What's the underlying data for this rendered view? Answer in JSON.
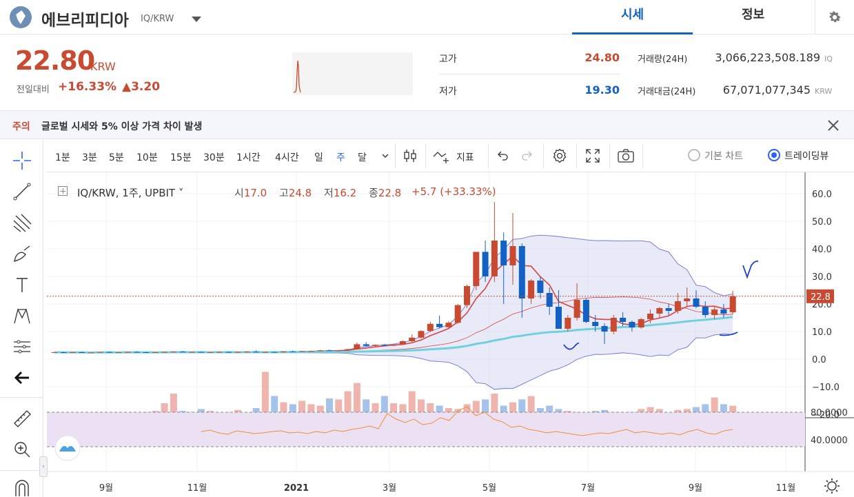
{
  "header": {
    "coin_name": "에브리피디아",
    "pair": "IQ/KRW",
    "tabs": [
      "시세",
      "정보"
    ],
    "active_tab": "시세"
  },
  "summary": {
    "price": "22.80",
    "unit": "KRW",
    "change_label": "전일대비",
    "change_rate": "+16.33%",
    "change_amount": "▲3.20",
    "high_label": "고가",
    "high_value": "24.80",
    "low_label": "저가",
    "low_value": "19.30",
    "volume_label": "거래량(24H)",
    "volume_value": "3,066,223,508.189",
    "volume_unit": "IQ",
    "amount_label": "거래대금(24H)",
    "amount_value": "67,071,077,345",
    "amount_unit": "KRW"
  },
  "notice": {
    "tag": "주의",
    "text": "글로벌 시세와 5% 이상 가격 차이 발생"
  },
  "toolbar": {
    "timeframes": [
      "1분",
      "3분",
      "5분",
      "10분",
      "15분",
      "30분",
      "1시간",
      "4시간",
      "일",
      "주",
      "달"
    ],
    "active_timeframe": "주",
    "indicator_label": "지표",
    "chart_modes": [
      "기본 차트",
      "트레이딩뷰"
    ],
    "active_mode": "트레이딩뷰"
  },
  "legend": {
    "symbol": "IQ/KRW, 1주, UPBIT",
    "open_label": "시",
    "open": "17.0",
    "high_label": "고",
    "high": "24.8",
    "low_label": "저",
    "low": "16.2",
    "close_label": "종",
    "close": "22.8",
    "change": "+5.7 (+33.33%)"
  },
  "chart_data": {
    "type": "candlestick",
    "price_axis": {
      "ticks": [
        "60.0",
        "50.0",
        "40.0",
        "30.0",
        "20.0",
        "10.0",
        "0.0",
        "−10.0",
        "−20.0"
      ],
      "min": -20,
      "max": 60
    },
    "last_price_label": "22.8",
    "last_price": 22.8,
    "rsi_axis": {
      "ticks": [
        "80.0000",
        "40.0000"
      ],
      "upper": 70,
      "lower": 30
    },
    "time_labels": [
      "9월",
      "11월",
      "2021",
      "3월",
      "5월",
      "7월",
      "9월",
      "11월"
    ],
    "candles": [
      [
        2.4,
        2.6,
        2.2,
        2.5
      ],
      [
        2.5,
        2.7,
        2.3,
        2.4
      ],
      [
        2.4,
        2.6,
        2.2,
        2.5
      ],
      [
        2.5,
        2.7,
        2.3,
        2.3
      ],
      [
        2.3,
        2.5,
        2.1,
        2.4
      ],
      [
        2.4,
        2.6,
        2.2,
        2.6
      ],
      [
        2.6,
        2.8,
        2.4,
        2.4
      ],
      [
        2.4,
        2.6,
        2.2,
        2.5
      ],
      [
        2.5,
        2.7,
        2.3,
        2.6
      ],
      [
        2.6,
        2.8,
        2.4,
        2.5
      ],
      [
        2.5,
        2.7,
        2.3,
        2.4
      ],
      [
        2.4,
        2.6,
        2.2,
        2.5
      ],
      [
        2.5,
        2.7,
        2.3,
        2.6
      ],
      [
        2.6,
        2.9,
        2.4,
        2.7
      ],
      [
        2.7,
        3.0,
        2.5,
        2.5
      ],
      [
        2.5,
        2.7,
        2.3,
        2.6
      ],
      [
        2.6,
        2.8,
        2.4,
        2.4
      ],
      [
        2.4,
        2.6,
        2.2,
        2.5
      ],
      [
        2.5,
        2.8,
        2.3,
        2.6
      ],
      [
        2.6,
        2.8,
        2.4,
        2.4
      ],
      [
        2.4,
        2.6,
        2.2,
        2.6
      ],
      [
        2.6,
        2.9,
        2.4,
        2.7
      ],
      [
        2.7,
        3.2,
        2.5,
        2.5
      ],
      [
        2.5,
        2.7,
        2.3,
        2.6
      ],
      [
        2.6,
        2.8,
        2.4,
        2.5
      ],
      [
        2.5,
        2.8,
        2.3,
        2.8
      ],
      [
        2.8,
        3.1,
        2.6,
        2.7
      ],
      [
        2.7,
        3.0,
        2.6,
        2.9
      ],
      [
        2.9,
        3.1,
        2.7,
        2.9
      ],
      [
        2.9,
        3.4,
        2.8,
        3.2
      ],
      [
        3.2,
        3.5,
        3.0,
        3.0
      ],
      [
        3.0,
        3.3,
        2.8,
        3.2
      ],
      [
        3.2,
        3.8,
        3.0,
        3.6
      ],
      [
        3.6,
        6.0,
        3.4,
        5.4
      ],
      [
        5.4,
        6.2,
        4.6,
        4.8
      ],
      [
        4.8,
        5.3,
        4.4,
        5.2
      ],
      [
        5.2,
        5.6,
        4.8,
        4.9
      ],
      [
        4.9,
        5.4,
        4.7,
        5.3
      ],
      [
        5.3,
        6.8,
        5.1,
        6.5
      ],
      [
        6.5,
        9.0,
        6.2,
        7.8
      ],
      [
        7.8,
        10.5,
        7.5,
        10.2
      ],
      [
        10.2,
        13.5,
        9.8,
        12.8
      ],
      [
        12.8,
        15.8,
        11.2,
        11.6
      ],
      [
        11.6,
        13.8,
        11.0,
        13.2
      ],
      [
        13.2,
        20.0,
        12.8,
        19.6
      ],
      [
        19.6,
        27.0,
        18.5,
        26.5
      ],
      [
        26.5,
        38.0,
        25.0,
        38.9
      ],
      [
        38.9,
        43.0,
        28.0,
        30.0
      ],
      [
        30.0,
        57.0,
        28.0,
        43.0
      ],
      [
        43.0,
        46.0,
        20.0,
        34.0
      ],
      [
        34.0,
        53.0,
        27.0,
        41.0
      ],
      [
        41.0,
        42.0,
        15.0,
        22.0
      ],
      [
        22.0,
        29.0,
        20.0,
        28.5
      ],
      [
        28.5,
        30.0,
        22.0,
        24.0
      ],
      [
        24.0,
        26.0,
        16.0,
        19.0
      ],
      [
        19.0,
        25.0,
        11.0,
        11.0
      ],
      [
        11.0,
        16.0,
        10.0,
        15.0
      ],
      [
        15.0,
        27.5,
        14.0,
        21.5
      ],
      [
        21.5,
        22.0,
        13.0,
        13.5
      ],
      [
        13.5,
        16.0,
        10.0,
        12.0
      ],
      [
        12.0,
        13.0,
        5.5,
        10.0
      ],
      [
        10.0,
        16.0,
        9.0,
        15.0
      ],
      [
        15.0,
        17.0,
        12.0,
        13.5
      ],
      [
        13.5,
        14.0,
        10.0,
        11.5
      ],
      [
        11.5,
        15.0,
        11.0,
        14.5
      ],
      [
        14.5,
        18.0,
        13.0,
        16.5
      ],
      [
        16.5,
        19.0,
        15.0,
        18.5
      ],
      [
        18.5,
        20.0,
        16.0,
        17.5
      ],
      [
        17.5,
        24.0,
        16.5,
        21.0
      ],
      [
        21.0,
        26.0,
        19.0,
        22.0
      ],
      [
        22.0,
        25.0,
        18.5,
        19.0
      ],
      [
        19.0,
        21.0,
        15.0,
        16.0
      ],
      [
        16.0,
        19.0,
        14.5,
        18.0
      ],
      [
        18.0,
        20.0,
        15.0,
        16.5
      ],
      [
        17.0,
        24.8,
        16.2,
        22.8
      ]
    ],
    "volumes_rel": [
      0.02,
      0.1,
      0.03,
      0.05,
      0.08,
      0.1,
      0.09,
      0.07,
      0.05,
      0.1,
      0.12,
      0.14,
      0.3,
      0.5,
      0.14,
      0.12,
      0.18,
      0.14,
      0.09,
      0.12,
      0.16,
      0.1,
      0.2,
      0.95,
      0.45,
      0.32,
      0.28,
      0.35,
      0.28,
      0.25,
      0.4,
      0.38,
      0.55,
      0.72,
      0.38,
      0.3,
      0.45,
      0.3,
      0.28,
      0.55,
      0.38,
      0.3,
      0.25,
      0.2,
      0.18,
      0.28,
      0.35,
      0.38,
      0.5,
      0.25,
      0.32,
      0.38,
      0.45,
      0.2,
      0.25,
      0.18,
      0.14,
      0.12,
      0.1,
      0.14,
      0.16,
      0.12,
      0.08,
      0.12,
      0.18,
      0.22,
      0.18,
      0.1,
      0.16,
      0.18,
      0.22,
      0.28,
      0.42,
      0.28,
      0.25,
      0.16,
      0.2,
      0.2,
      0.25
    ],
    "rsi": [
      52,
      54,
      50,
      48,
      53,
      51,
      49,
      50,
      52,
      53,
      50,
      51,
      49,
      52,
      50,
      54,
      52,
      55,
      57,
      60,
      56,
      78,
      70,
      65,
      70,
      62,
      64,
      72,
      68,
      82,
      88,
      75,
      80,
      70,
      66,
      58,
      60,
      55,
      53,
      50,
      52,
      50,
      48,
      46,
      48,
      50,
      49,
      52,
      55,
      50,
      52,
      50,
      48,
      50,
      47,
      52,
      55,
      50,
      48,
      53,
      55
    ],
    "colors": {
      "up": "#c84a31",
      "down": "#1261c4",
      "ma_red": "#d64545",
      "ma_cyan": "#6fd0de",
      "band_fill": "#d7d8f0",
      "band_line": "#6e6fe0",
      "rsi_line": "#f08c3a",
      "rsi_fill": "#ece1f2"
    }
  }
}
